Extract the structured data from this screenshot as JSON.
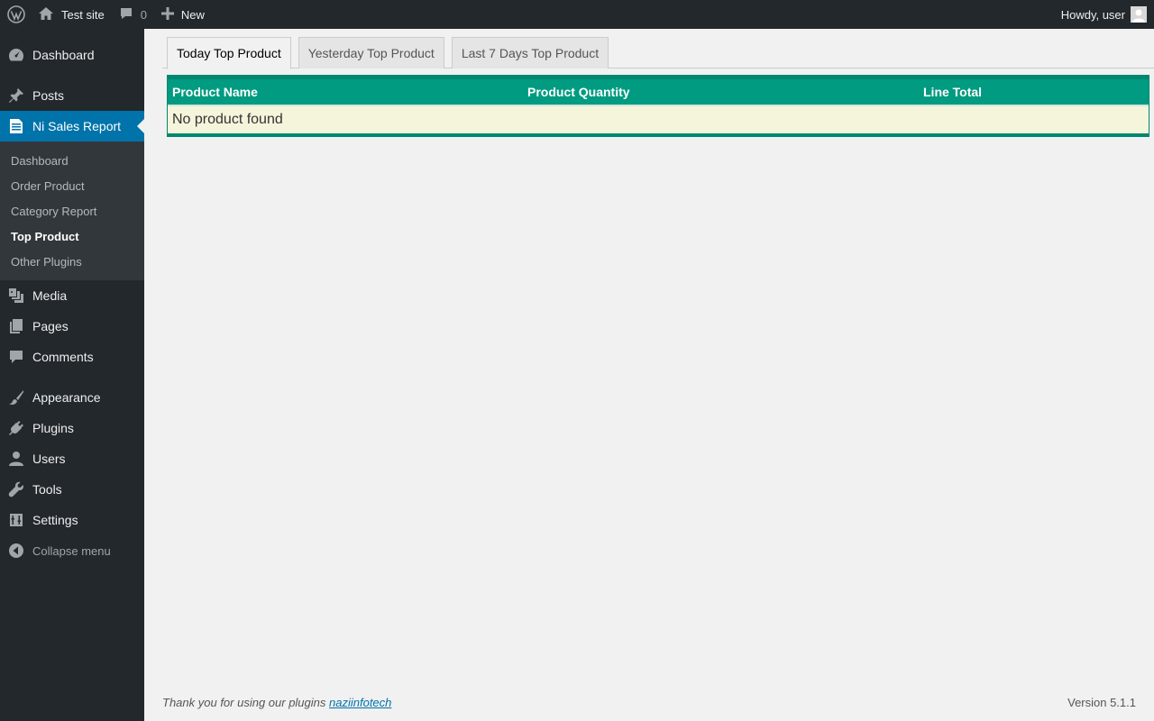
{
  "adminbar": {
    "site_name": "Test site",
    "comments_count": "0",
    "new_label": "New",
    "howdy": "Howdy, user"
  },
  "sidebar": {
    "items": [
      {
        "label": "Dashboard",
        "icon": "dashboard-icon"
      },
      {
        "label": "Posts",
        "icon": "pushpin-icon"
      },
      {
        "label": "Ni Sales Report",
        "icon": "document-icon"
      }
    ],
    "submenu": [
      {
        "label": "Dashboard"
      },
      {
        "label": "Order Product"
      },
      {
        "label": "Category Report"
      },
      {
        "label": "Top Product"
      },
      {
        "label": "Other Plugins"
      }
    ],
    "items_after": [
      {
        "label": "Media",
        "icon": "media-icon"
      },
      {
        "label": "Pages",
        "icon": "pages-icon"
      },
      {
        "label": "Comments",
        "icon": "comment-icon"
      },
      {
        "label": "Appearance",
        "icon": "brush-icon"
      },
      {
        "label": "Plugins",
        "icon": "plug-icon"
      },
      {
        "label": "Users",
        "icon": "user-icon"
      },
      {
        "label": "Tools",
        "icon": "wrench-icon"
      },
      {
        "label": "Settings",
        "icon": "settings-icon"
      }
    ],
    "collapse_label": "Collapse menu"
  },
  "tabs": [
    {
      "label": "Today Top Product"
    },
    {
      "label": "Yesterday Top Product"
    },
    {
      "label": "Last 7 Days Top Product"
    }
  ],
  "table": {
    "headers": [
      "Product Name",
      "Product Quantity",
      "Line Total"
    ],
    "empty_message": "No product found"
  },
  "footer": {
    "thanks_text": "Thank you for using our plugins",
    "link_text": "naziinfotech",
    "version": "Version 5.1.1"
  },
  "colors": {
    "admin_bg": "#23282d",
    "accent": "#0073aa",
    "table_header": "#009b80",
    "table_row": "#f5f5dc"
  }
}
